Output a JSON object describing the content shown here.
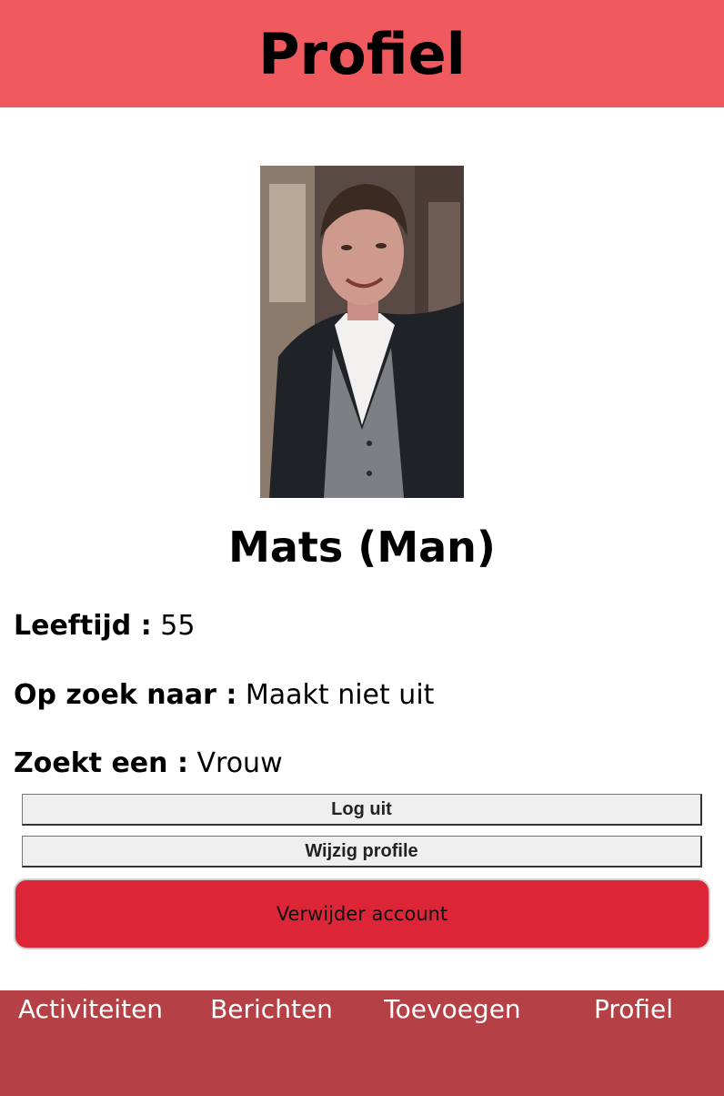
{
  "colors": {
    "header_bg": "#f05a5e",
    "bottom_nav_bg": "#b54045",
    "delete_button_bg": "#dc2536"
  },
  "header": {
    "title": "Profiel"
  },
  "profile": {
    "photo_icon": "profile-photo",
    "name": "Mats (Man)",
    "age_label": "Leeftijd :",
    "age_value": "55",
    "looking_for_label": "Op zoek naar :",
    "looking_for_value": "Maakt niet uit",
    "seeks_label": "Zoekt een :",
    "seeks_value": "Vrouw"
  },
  "actions": {
    "logout_label": "Log uit",
    "edit_label": "Wijzig profile",
    "delete_label": "Verwijder account"
  },
  "bottom_nav": {
    "items": [
      {
        "label": "Activiteiten"
      },
      {
        "label": "Berichten"
      },
      {
        "label": "Toevoegen"
      },
      {
        "label": "Profiel"
      }
    ]
  }
}
